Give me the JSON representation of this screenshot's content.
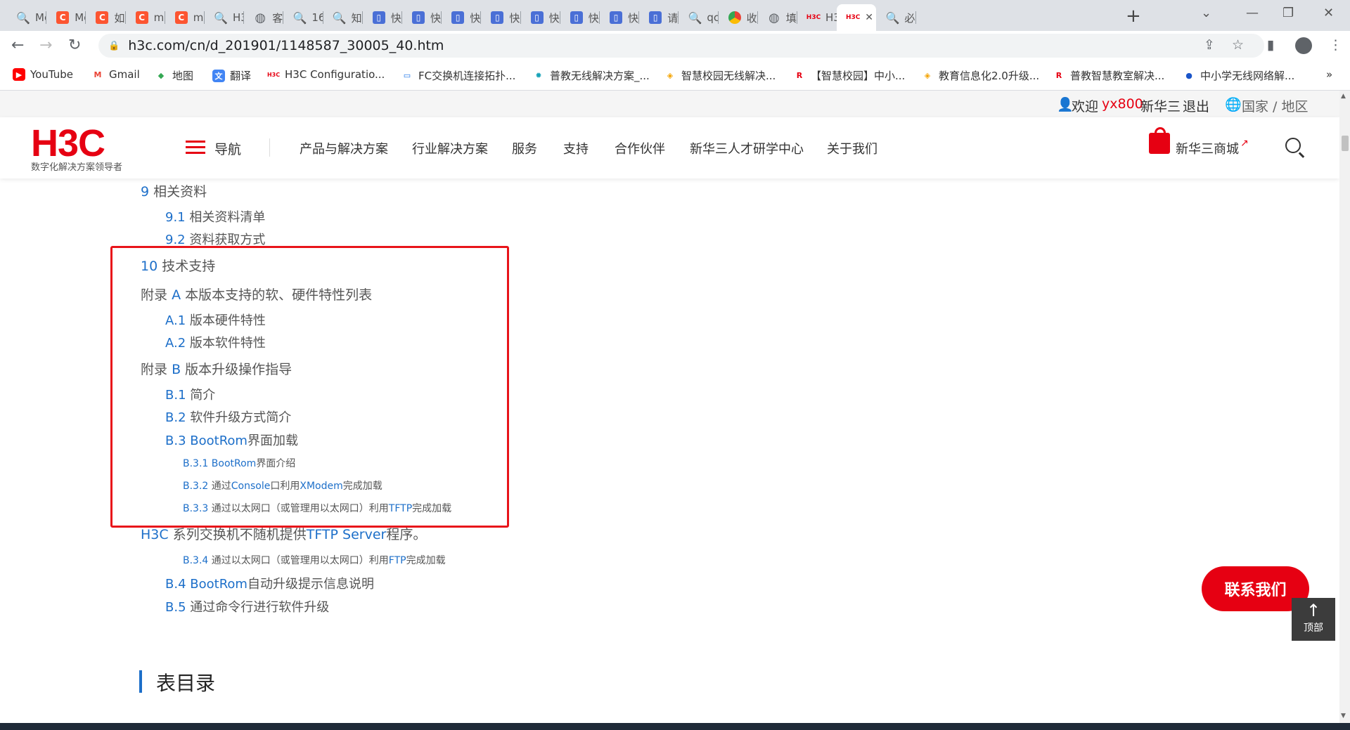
{
  "browser": {
    "tabs": [
      {
        "icon": "search-icon",
        "title": "Mc"
      },
      {
        "icon": "csdn-icon",
        "title": "Mc"
      },
      {
        "icon": "csdn-icon",
        "title": "如"
      },
      {
        "icon": "csdn-icon",
        "title": "mc"
      },
      {
        "icon": "csdn-icon",
        "title": "mc"
      },
      {
        "icon": "search-icon",
        "title": "H3"
      },
      {
        "icon": "globe-icon",
        "title": "客"
      },
      {
        "icon": "search-icon",
        "title": "16"
      },
      {
        "icon": "search-icon",
        "title": "知"
      },
      {
        "icon": "doc-icon",
        "title": "快"
      },
      {
        "icon": "doc-icon",
        "title": "快"
      },
      {
        "icon": "doc-icon",
        "title": "快"
      },
      {
        "icon": "doc-icon",
        "title": "快"
      },
      {
        "icon": "doc-icon",
        "title": "快"
      },
      {
        "icon": "doc-icon",
        "title": "快"
      },
      {
        "icon": "doc-icon",
        "title": "快"
      },
      {
        "icon": "doc-icon",
        "title": "请"
      },
      {
        "icon": "search-icon",
        "title": "qc"
      },
      {
        "icon": "chrome-icon",
        "title": "收"
      },
      {
        "icon": "globe-icon",
        "title": "填"
      },
      {
        "icon": "h3c-icon",
        "title": "H3"
      },
      {
        "icon": "h3c-icon",
        "title": ""
      },
      {
        "icon": "search-icon",
        "title": "必"
      }
    ],
    "active_tab_close": "✕",
    "new_tab": "+",
    "url": "h3c.com/cn/d_201901/1148587_30005_40.htm",
    "bookmarks": [
      {
        "icon": "youtube-icon",
        "label": "YouTube"
      },
      {
        "icon": "gmail-icon",
        "label": "Gmail"
      },
      {
        "icon": "map-icon",
        "label": "地图"
      },
      {
        "icon": "translate-icon",
        "label": "翻译"
      },
      {
        "icon": "h3c-icon",
        "label": "H3C Configuratio..."
      },
      {
        "icon": "tv-icon",
        "label": "FC交换机连接拓扑..."
      },
      {
        "icon": "gear-icon",
        "label": "普教无线解决方案_..."
      },
      {
        "icon": "diamond-icon",
        "label": "智慧校园无线解决..."
      },
      {
        "icon": "ruijie-icon",
        "label": "【智慧校园】中小..."
      },
      {
        "icon": "diamond-icon",
        "label": "教育信息化2.0升级..."
      },
      {
        "icon": "ruijie-icon",
        "label": "普教智慧教室解决..."
      },
      {
        "icon": "circle-icon",
        "label": "中小学无线网络解..."
      }
    ],
    "bookmarks_more": "»"
  },
  "site": {
    "topbar": {
      "welcome": "欢迎",
      "username": "yx800",
      "company": "新华三",
      "logout": "退出",
      "region": "国家 / 地区"
    },
    "logo": "H3C",
    "logo_tagline": "数字化解决方案领导者",
    "nav_label": "导航",
    "menu": [
      "产品与解决方案",
      "行业解决方案",
      "服务",
      "支持",
      "合作伙伴",
      "新华三人才研学中心",
      "关于我们"
    ],
    "mall": "新华三商城"
  },
  "toc": {
    "s9": {
      "num": "9",
      "text": "相关资料"
    },
    "s9_1": {
      "num": "9.1",
      "text": "相关资料清单"
    },
    "s9_2": {
      "num": "9.2",
      "text": "资料获取方式"
    },
    "s10": {
      "num": "10",
      "text": "技术支持"
    },
    "appA": {
      "pre": "附录",
      "num": "A",
      "text": "本版本支持的软、硬件特性列表"
    },
    "a1": {
      "num": "A.1",
      "text": "版本硬件特性"
    },
    "a2": {
      "num": "A.2",
      "text": "版本软件特性"
    },
    "appB": {
      "pre": "附录",
      "num": "B",
      "text": "版本升级操作指导"
    },
    "b1": {
      "num": "B.1",
      "text": "简介"
    },
    "b2": {
      "num": "B.2",
      "text": "软件升级方式简介"
    },
    "b3": {
      "num": "B.3",
      "a": "BootRom",
      "b": "界面加载"
    },
    "b31": {
      "num": "B.3.1",
      "a": "BootRom",
      "b": "界面介绍"
    },
    "b32": {
      "num": "B.3.2",
      "a": "通过",
      "b": "Console",
      "c": "口利用",
      "d": "XModem",
      "e": "完成加载"
    },
    "b33": {
      "num": "B.3.3",
      "a": "通过以太网口（或管理用以太网口）利用",
      "b": "TFTP",
      "c": "完成加载"
    },
    "note": {
      "a": "H3C",
      "b": "系列交换机不随机提供",
      "c": "TFTP Server",
      "d": "程序。"
    },
    "b34": {
      "num": "B.3.4",
      "a": "通过以太网口（或管理用以太网口）利用",
      "b": "FTP",
      "c": "完成加载"
    },
    "b4": {
      "num": "B.4",
      "a": "BootRom",
      "b": "自动升级提示信息说明"
    },
    "b5": {
      "num": "B.5",
      "text": "通过命令行进行软件升级"
    }
  },
  "section_title": "表目录",
  "contact_button": "联系我们",
  "back_top": {
    "arrow": "↑",
    "label": "顶部"
  }
}
